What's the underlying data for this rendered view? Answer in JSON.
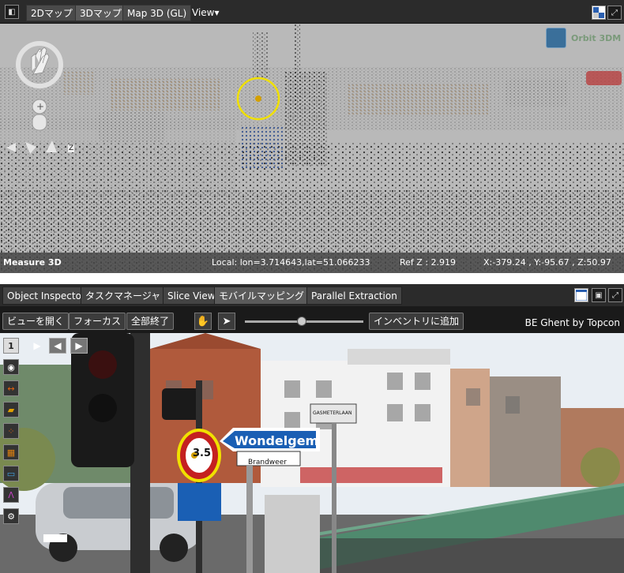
{
  "toolbar": {
    "panel_toggle_icon": "panel-toggle-icon",
    "tabs": [
      {
        "label": "2Dマップ",
        "active": false
      },
      {
        "label": "3Dマップ",
        "active": true
      },
      {
        "label": "Map 3D (GL)",
        "active": false
      }
    ],
    "view_menu": "View▾",
    "layout_icon": "layout-icon",
    "fullscreen_icon": "fullscreen-icon"
  },
  "view3d": {
    "logo_text": "Orbit 3DM",
    "status": {
      "mode": "Measure 3D",
      "local": "Local: lon=3.714643,lat=51.066233",
      "ref_z": "Ref Z : 2.919",
      "xyz": "X:-379.24 , Y:-95.67 , Z:50.97"
    },
    "nav_z_label": "Z"
  },
  "panel_tabs": [
    {
      "label": "Object Inspector",
      "active": false
    },
    {
      "label": "タスクマネージャ",
      "active": false
    },
    {
      "label": "Slice View",
      "active": false
    },
    {
      "label": "モバイルマッピング",
      "active": true
    },
    {
      "label": "Parallel Extraction",
      "active": false
    }
  ],
  "mm_toolbar": {
    "open_view": "ビューを開く",
    "focus": "フォーカス",
    "close_all": "全部終了",
    "add_inventory": "インベントリに追加",
    "provider": "BE Ghent by Topcon",
    "slider_value": 0.48
  },
  "photo": {
    "frame_label": "1",
    "sign_text": "Wondelgem",
    "sign_sub": "Brandweer",
    "street_sign": "GASMETERLAAN",
    "weight_limit": "3.5"
  },
  "colors": {
    "accent": "#f0e000",
    "toolbar_bg": "#2b2b2b",
    "cloud_bg": "#b8b8b8"
  }
}
